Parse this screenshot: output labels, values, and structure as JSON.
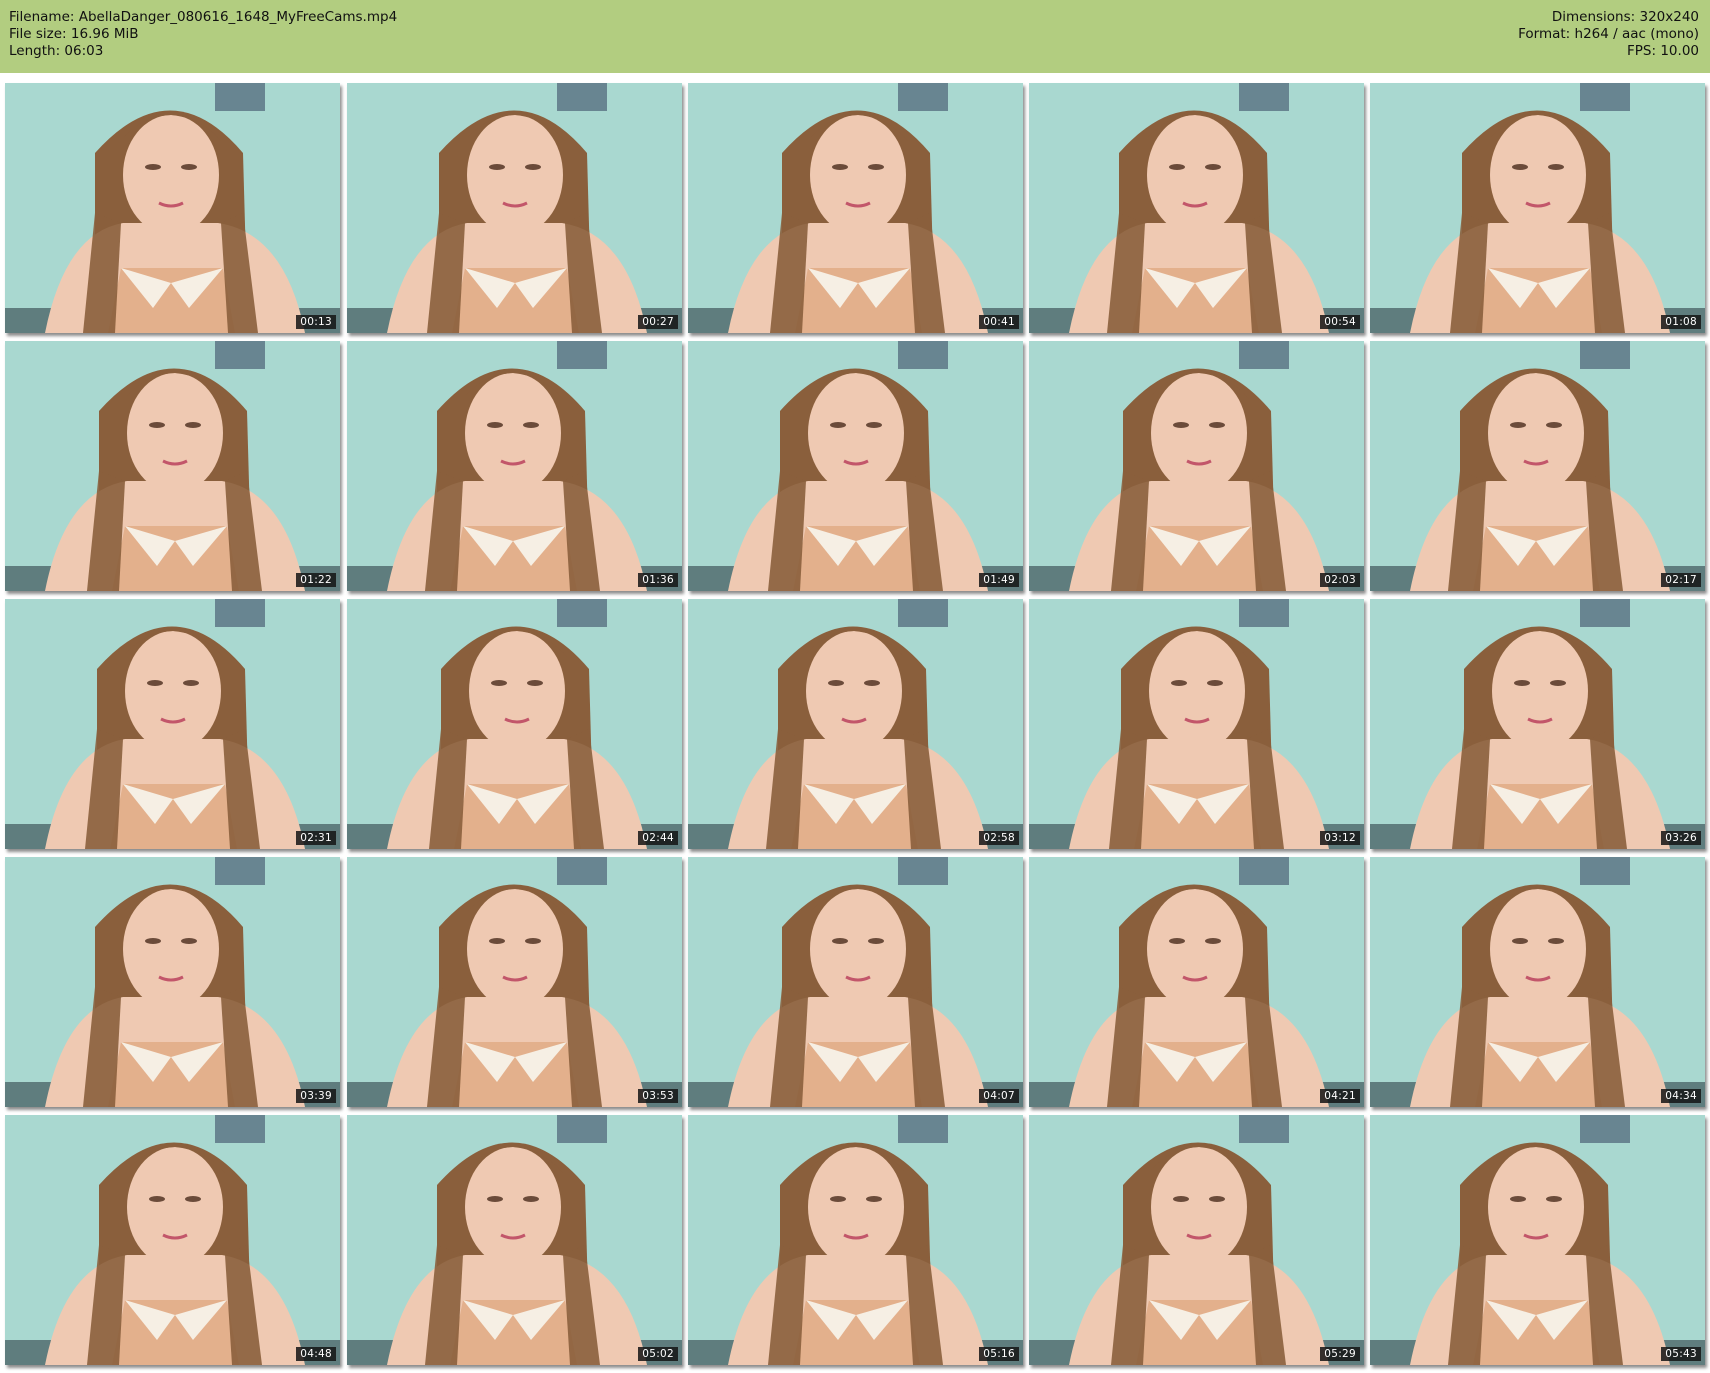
{
  "header": {
    "left": [
      "Filename: AbellaDanger_080616_1648_MyFreeCams.mp4",
      "File size: 16.96 MiB",
      "Length: 06:03"
    ],
    "right": [
      "Dimensions: 320x240",
      "Format: h264 / aac (mono)",
      "FPS: 10.00"
    ]
  },
  "colors": {
    "header_bg": "#b2cd80",
    "wall": "#a6d6ce",
    "hair": "#8a5f3c",
    "skin": "#efc9b2",
    "collar": "#f6efe4",
    "top": "#e3b08c"
  },
  "thumbnails": [
    {
      "timestamp": "00:13"
    },
    {
      "timestamp": "00:27"
    },
    {
      "timestamp": "00:41"
    },
    {
      "timestamp": "00:54"
    },
    {
      "timestamp": "01:08"
    },
    {
      "timestamp": "01:22"
    },
    {
      "timestamp": "01:36"
    },
    {
      "timestamp": "01:49"
    },
    {
      "timestamp": "02:03"
    },
    {
      "timestamp": "02:17"
    },
    {
      "timestamp": "02:31"
    },
    {
      "timestamp": "02:44"
    },
    {
      "timestamp": "02:58"
    },
    {
      "timestamp": "03:12"
    },
    {
      "timestamp": "03:26"
    },
    {
      "timestamp": "03:39"
    },
    {
      "timestamp": "03:53"
    },
    {
      "timestamp": "04:07"
    },
    {
      "timestamp": "04:21"
    },
    {
      "timestamp": "04:34"
    },
    {
      "timestamp": "04:48"
    },
    {
      "timestamp": "05:02"
    },
    {
      "timestamp": "05:16"
    },
    {
      "timestamp": "05:29"
    },
    {
      "timestamp": "05:43"
    }
  ]
}
